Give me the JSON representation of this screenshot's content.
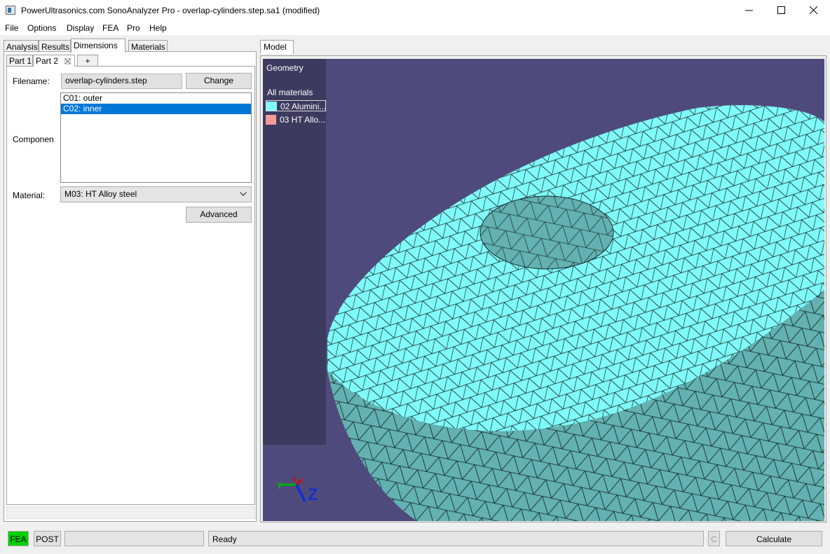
{
  "window": {
    "title": "PowerUltrasonics.com SonoAnalyzer Pro - overlap-cylinders.step.sa1 (modified)"
  },
  "menu": [
    "File",
    "Options",
    "Display",
    "FEA",
    "Pro",
    "Help"
  ],
  "left_tabs": [
    "Analysis",
    "Results",
    "Dimensions",
    "Materials"
  ],
  "active_left_tab": "Dimensions",
  "part_tabs": [
    "Part 1",
    "Part 2",
    "+"
  ],
  "active_part_tab": "Part 2",
  "dimensions": {
    "filename_label": "Filename:",
    "filename_value": "overlap-cylinders.step",
    "change_label": "Change",
    "components_label": "Componen",
    "components": [
      "C01: outer",
      "C02: inner"
    ],
    "selected_component": "C02: inner",
    "material_label": "Material:",
    "material_value": "M03: HT Alloy steel",
    "advanced_label": "Advanced"
  },
  "model": {
    "tab_label": "Model",
    "geometry_label": "Geometry",
    "all_materials_label": "All materials",
    "materials": [
      {
        "label": "02 Alumini...",
        "color": "#7ffbfb"
      },
      {
        "label": "03 HT Allo...",
        "color": "#f49a9a"
      }
    ],
    "background_color": "#4e4b7c",
    "mesh_top_color": "#7ffbfb",
    "mesh_side_color": "#63b1b1",
    "axis_labels": {
      "x": "X",
      "y": "Y",
      "z": "Z"
    }
  },
  "status": {
    "fea_label": "FEA",
    "fea_color": "#00d100",
    "post_label": "POST",
    "progress_text": "",
    "status_text": "Ready",
    "c_label": "C",
    "calculate_label": "Calculate"
  }
}
